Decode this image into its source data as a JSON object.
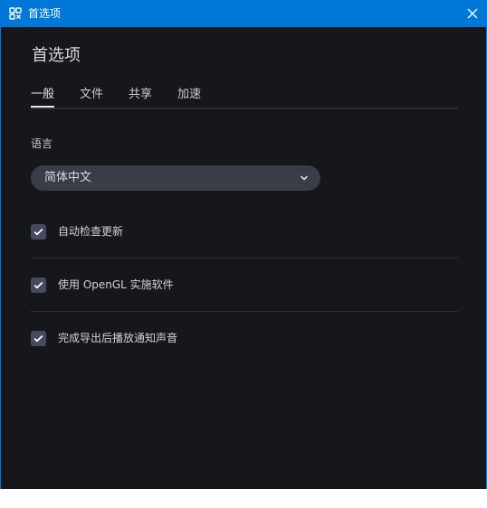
{
  "window": {
    "title": "首选项"
  },
  "page": {
    "heading": "首选项"
  },
  "tabs": [
    {
      "label": "一般",
      "active": true
    },
    {
      "label": "文件",
      "active": false
    },
    {
      "label": "共享",
      "active": false
    },
    {
      "label": "加速",
      "active": false
    }
  ],
  "language": {
    "label": "语言",
    "selected": "简体中文"
  },
  "options": [
    {
      "label": "自动检查更新",
      "checked": true
    },
    {
      "label": "使用 OpenGL 实施软件",
      "checked": true
    },
    {
      "label": "完成导出后播放通知声音",
      "checked": true
    }
  ],
  "colors": {
    "titlebar": "#0078d7",
    "background": "#16171b",
    "control": "#3a3c47",
    "checkbox": "#454a5e"
  },
  "icons": {
    "app": "app-icon",
    "close": "close-icon",
    "dropdown": "chevron-down-icon",
    "check": "check-icon"
  }
}
